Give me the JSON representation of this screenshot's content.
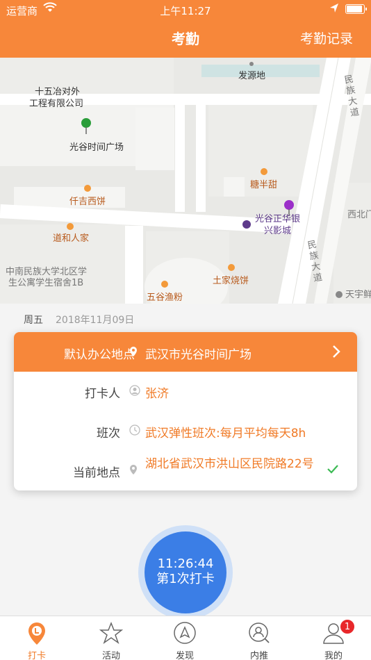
{
  "status_bar": {
    "carrier": "运营商",
    "time": "上午11:27"
  },
  "nav": {
    "title": "考勤",
    "right_action": "考勤记录"
  },
  "map": {
    "labels": {
      "fayuan": "发源地",
      "company_line1": "十五冶对外",
      "company_line2": "工程有限公司",
      "guanggu_plaza": "光谷时间广场",
      "tangbantian": "糖半甜",
      "qianji": "仟吉西饼",
      "daohe": "道和人家",
      "cinema_line1": "光谷正华银",
      "cinema_line2": "兴影城",
      "minzu_road_top": "民族大道",
      "minzu_road_bottom": "民族大道",
      "xibeimen": "西北门",
      "dorm_line1": "中南民族大学北区学",
      "dorm_line2": "生公寓学生宿舍1B",
      "tujia": "土家烧饼",
      "wugu": "五谷渔粉",
      "tianyu": "天宇鲜"
    }
  },
  "date": {
    "weekday": "周五",
    "value": "2018年11月09日"
  },
  "card": {
    "office_label": "默认办公地点",
    "office_value": "武汉市光谷时间广场",
    "rows": [
      {
        "label": "打卡人",
        "value": "张济"
      },
      {
        "label": "班次",
        "value": "武汉弹性班次:每月平均每天8h"
      },
      {
        "label": "当前地点",
        "value": "湖北省武汉市洪山区民院路22号"
      }
    ]
  },
  "punch": {
    "time": "11:26:44",
    "label": "第1次打卡"
  },
  "tabs": [
    {
      "label": "打卡",
      "icon": "punch-pin-icon",
      "active": true
    },
    {
      "label": "活动",
      "icon": "star-icon"
    },
    {
      "label": "发现",
      "icon": "compass-icon"
    },
    {
      "label": "内推",
      "icon": "search-person-icon"
    },
    {
      "label": "我的",
      "icon": "person-icon",
      "badge": "1"
    }
  ],
  "colors": {
    "brand": "#f7873a",
    "accent_text": "#f07a26",
    "punch_blue": "#3b7ee6"
  }
}
